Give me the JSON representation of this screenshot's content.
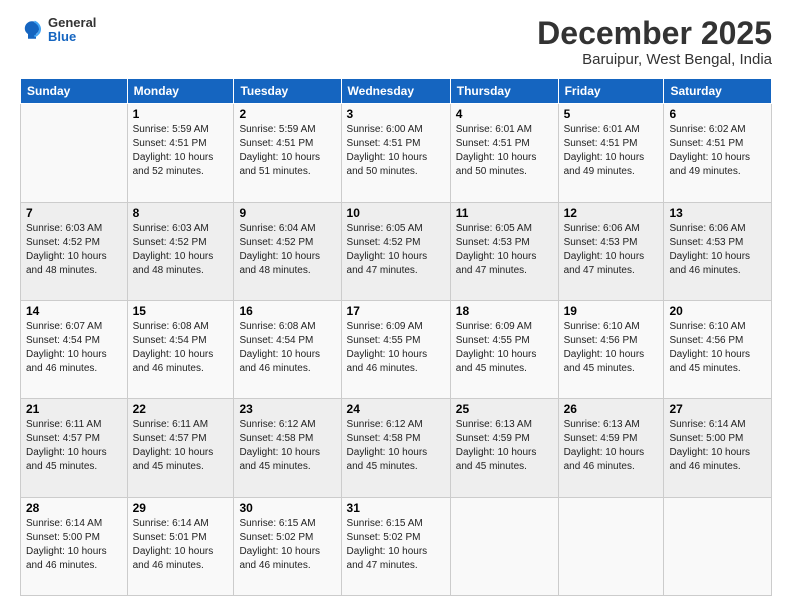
{
  "logo": {
    "general": "General",
    "blue": "Blue"
  },
  "header": {
    "month": "December 2025",
    "location": "Baruipur, West Bengal, India"
  },
  "days_of_week": [
    "Sunday",
    "Monday",
    "Tuesday",
    "Wednesday",
    "Thursday",
    "Friday",
    "Saturday"
  ],
  "weeks": [
    [
      {
        "day": "",
        "info": ""
      },
      {
        "day": "1",
        "info": "Sunrise: 5:59 AM\nSunset: 4:51 PM\nDaylight: 10 hours\nand 52 minutes."
      },
      {
        "day": "2",
        "info": "Sunrise: 5:59 AM\nSunset: 4:51 PM\nDaylight: 10 hours\nand 51 minutes."
      },
      {
        "day": "3",
        "info": "Sunrise: 6:00 AM\nSunset: 4:51 PM\nDaylight: 10 hours\nand 50 minutes."
      },
      {
        "day": "4",
        "info": "Sunrise: 6:01 AM\nSunset: 4:51 PM\nDaylight: 10 hours\nand 50 minutes."
      },
      {
        "day": "5",
        "info": "Sunrise: 6:01 AM\nSunset: 4:51 PM\nDaylight: 10 hours\nand 49 minutes."
      },
      {
        "day": "6",
        "info": "Sunrise: 6:02 AM\nSunset: 4:51 PM\nDaylight: 10 hours\nand 49 minutes."
      }
    ],
    [
      {
        "day": "7",
        "info": "Sunrise: 6:03 AM\nSunset: 4:52 PM\nDaylight: 10 hours\nand 48 minutes."
      },
      {
        "day": "8",
        "info": "Sunrise: 6:03 AM\nSunset: 4:52 PM\nDaylight: 10 hours\nand 48 minutes."
      },
      {
        "day": "9",
        "info": "Sunrise: 6:04 AM\nSunset: 4:52 PM\nDaylight: 10 hours\nand 48 minutes."
      },
      {
        "day": "10",
        "info": "Sunrise: 6:05 AM\nSunset: 4:52 PM\nDaylight: 10 hours\nand 47 minutes."
      },
      {
        "day": "11",
        "info": "Sunrise: 6:05 AM\nSunset: 4:53 PM\nDaylight: 10 hours\nand 47 minutes."
      },
      {
        "day": "12",
        "info": "Sunrise: 6:06 AM\nSunset: 4:53 PM\nDaylight: 10 hours\nand 47 minutes."
      },
      {
        "day": "13",
        "info": "Sunrise: 6:06 AM\nSunset: 4:53 PM\nDaylight: 10 hours\nand 46 minutes."
      }
    ],
    [
      {
        "day": "14",
        "info": "Sunrise: 6:07 AM\nSunset: 4:54 PM\nDaylight: 10 hours\nand 46 minutes."
      },
      {
        "day": "15",
        "info": "Sunrise: 6:08 AM\nSunset: 4:54 PM\nDaylight: 10 hours\nand 46 minutes."
      },
      {
        "day": "16",
        "info": "Sunrise: 6:08 AM\nSunset: 4:54 PM\nDaylight: 10 hours\nand 46 minutes."
      },
      {
        "day": "17",
        "info": "Sunrise: 6:09 AM\nSunset: 4:55 PM\nDaylight: 10 hours\nand 46 minutes."
      },
      {
        "day": "18",
        "info": "Sunrise: 6:09 AM\nSunset: 4:55 PM\nDaylight: 10 hours\nand 45 minutes."
      },
      {
        "day": "19",
        "info": "Sunrise: 6:10 AM\nSunset: 4:56 PM\nDaylight: 10 hours\nand 45 minutes."
      },
      {
        "day": "20",
        "info": "Sunrise: 6:10 AM\nSunset: 4:56 PM\nDaylight: 10 hours\nand 45 minutes."
      }
    ],
    [
      {
        "day": "21",
        "info": "Sunrise: 6:11 AM\nSunset: 4:57 PM\nDaylight: 10 hours\nand 45 minutes."
      },
      {
        "day": "22",
        "info": "Sunrise: 6:11 AM\nSunset: 4:57 PM\nDaylight: 10 hours\nand 45 minutes."
      },
      {
        "day": "23",
        "info": "Sunrise: 6:12 AM\nSunset: 4:58 PM\nDaylight: 10 hours\nand 45 minutes."
      },
      {
        "day": "24",
        "info": "Sunrise: 6:12 AM\nSunset: 4:58 PM\nDaylight: 10 hours\nand 45 minutes."
      },
      {
        "day": "25",
        "info": "Sunrise: 6:13 AM\nSunset: 4:59 PM\nDaylight: 10 hours\nand 45 minutes."
      },
      {
        "day": "26",
        "info": "Sunrise: 6:13 AM\nSunset: 4:59 PM\nDaylight: 10 hours\nand 46 minutes."
      },
      {
        "day": "27",
        "info": "Sunrise: 6:14 AM\nSunset: 5:00 PM\nDaylight: 10 hours\nand 46 minutes."
      }
    ],
    [
      {
        "day": "28",
        "info": "Sunrise: 6:14 AM\nSunset: 5:00 PM\nDaylight: 10 hours\nand 46 minutes."
      },
      {
        "day": "29",
        "info": "Sunrise: 6:14 AM\nSunset: 5:01 PM\nDaylight: 10 hours\nand 46 minutes."
      },
      {
        "day": "30",
        "info": "Sunrise: 6:15 AM\nSunset: 5:02 PM\nDaylight: 10 hours\nand 46 minutes."
      },
      {
        "day": "31",
        "info": "Sunrise: 6:15 AM\nSunset: 5:02 PM\nDaylight: 10 hours\nand 47 minutes."
      },
      {
        "day": "",
        "info": ""
      },
      {
        "day": "",
        "info": ""
      },
      {
        "day": "",
        "info": ""
      }
    ]
  ]
}
